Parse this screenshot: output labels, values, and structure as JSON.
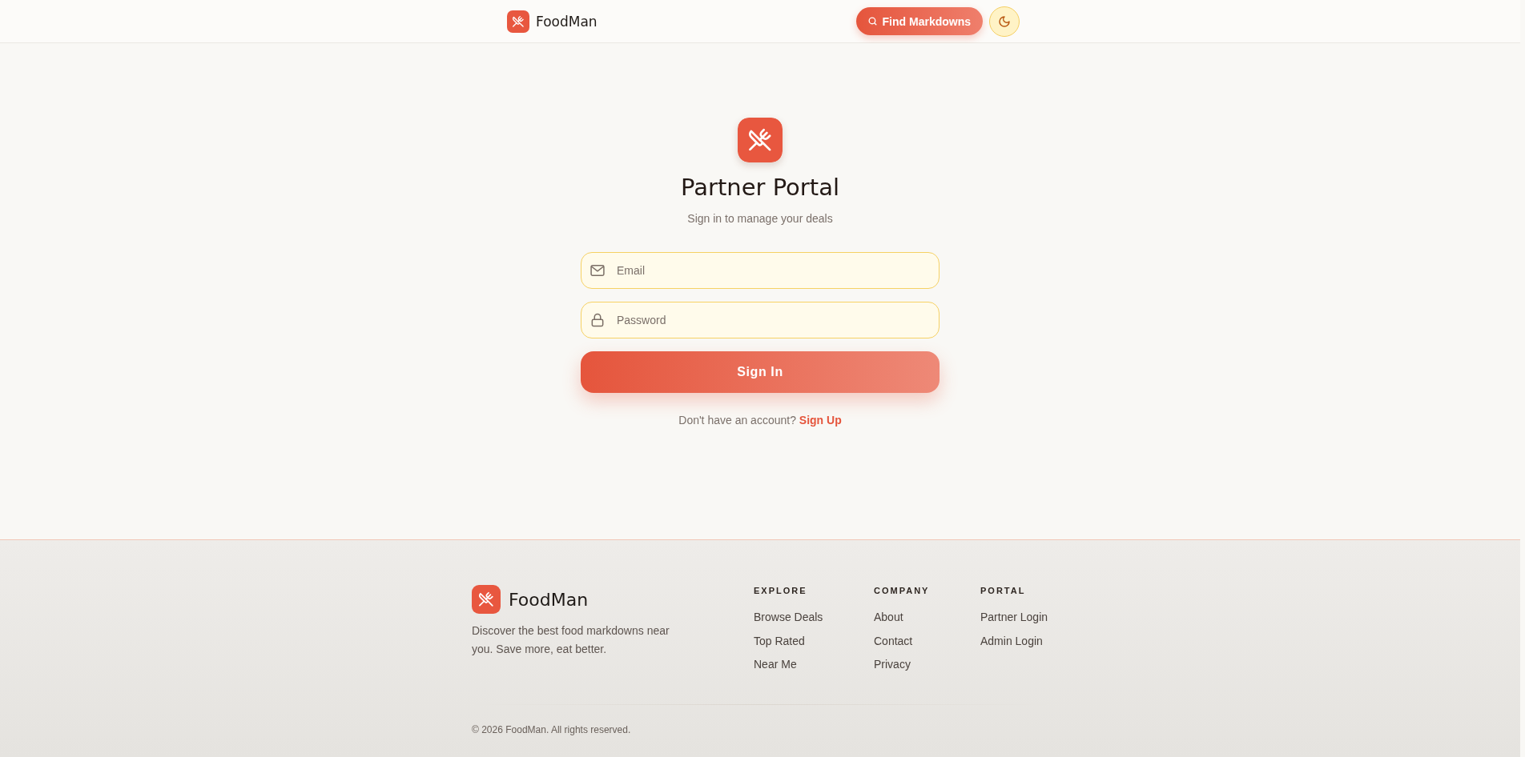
{
  "header": {
    "brand": "FoodMan",
    "search_button": "Find Markdowns"
  },
  "login": {
    "title": "Partner Portal",
    "subtitle": "Sign in to manage your deals",
    "fields": [
      {
        "kind": "email",
        "placeholder": "Email"
      },
      {
        "kind": "password",
        "placeholder": "Password"
      }
    ],
    "submit": "Sign In",
    "signup_prompt": "Don't have an account?",
    "signup_link": "Sign Up"
  },
  "footer": {
    "brand": "FoodMan",
    "description": "Discover the best food markdowns near you. Save more, eat better.",
    "columns": [
      {
        "heading": "EXPLORE",
        "links": [
          "Browse Deals",
          "Top Rated",
          "Near Me"
        ]
      },
      {
        "heading": "COMPANY",
        "links": [
          "About",
          "Contact",
          "Privacy"
        ]
      },
      {
        "heading": "PORTAL",
        "links": [
          "Partner Login",
          "Admin Login"
        ]
      }
    ],
    "copyright": "© 2026 FoodMan. All rights reserved."
  }
}
